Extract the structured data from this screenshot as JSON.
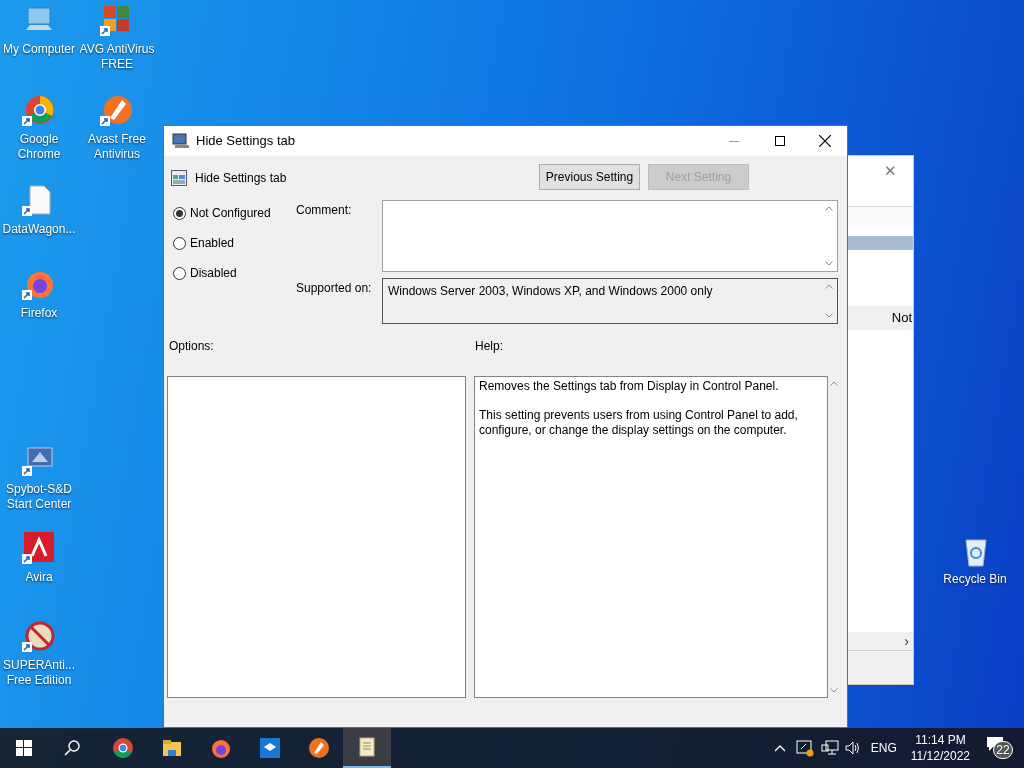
{
  "desktop_icons": [
    {
      "label": "My Computer"
    },
    {
      "label": "AVG AntiVirus FREE"
    },
    {
      "label": "Google Chrome"
    },
    {
      "label": "Avast Free Antivirus"
    },
    {
      "label": "DataWagon..."
    },
    {
      "label": "Firefox"
    },
    {
      "label": "Spybot-S&D Start Center"
    },
    {
      "label": "Avira"
    },
    {
      "label": "SUPERAnti... Free Edition"
    },
    {
      "label": "Recycle Bin"
    }
  ],
  "background_window": {
    "cell_text": "Not",
    "close_glyph": "✕",
    "scroll_glyph": "›"
  },
  "dialog": {
    "title": "Hide Settings tab",
    "setting_name": "Hide Settings tab",
    "nav_buttons": [
      {
        "label": "Previous Setting",
        "disabled": false
      },
      {
        "label": "Next Setting",
        "disabled": true
      }
    ],
    "states": [
      {
        "label": "Not Configured",
        "selected": true
      },
      {
        "label": "Enabled",
        "selected": false
      },
      {
        "label": "Disabled",
        "selected": false
      }
    ],
    "comment_label": "Comment:",
    "supported_label": "Supported on:",
    "supported_text": "Windows Server 2003, Windows XP, and Windows 2000 only",
    "options_label": "Options:",
    "help_label": "Help:",
    "help_paragraphs": [
      "Removes the Settings tab from Display in Control Panel.",
      "This setting prevents users from using Control Panel to add, configure, or change the display settings on the computer."
    ]
  },
  "taskbar": {
    "apps": [
      {
        "selected": false
      },
      {
        "selected": false
      },
      {
        "selected": false
      },
      {
        "selected": false
      },
      {
        "selected": false
      },
      {
        "selected": true
      }
    ],
    "language": "ENG",
    "time": "11:14 PM",
    "date": "11/12/2022",
    "notification_count": "22"
  }
}
